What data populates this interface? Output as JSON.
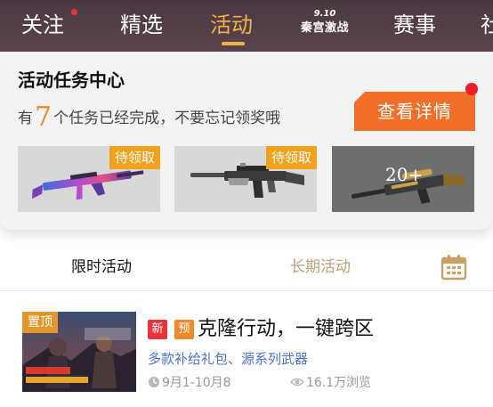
{
  "nav": {
    "tabs": [
      {
        "label": "关注",
        "has_dot": true
      },
      {
        "label": "精选"
      },
      {
        "label": "活动",
        "active": true
      },
      {
        "date": "9.10",
        "label": "秦宫激战"
      },
      {
        "label": "赛事"
      },
      {
        "label": "社"
      }
    ],
    "active_color": "#f4b04a"
  },
  "task_center": {
    "title": "活动任务中心",
    "subtitle_prefix": "有",
    "completed_count": "7",
    "subtitle_suffix": "个任务已经完成，不要忘记领奖哦",
    "detail_button": "查看详情",
    "rewards": [
      {
        "tag": "待领取",
        "icon": "colorful-rifle"
      },
      {
        "tag": "待领取",
        "icon": "silenced-rifle"
      },
      {
        "more_label": "20+",
        "icon": "sniper-rifle"
      }
    ]
  },
  "sub_tabs": {
    "limited": "限时活动",
    "long_term": "长期活动",
    "calendar_icon": "calendar-icon"
  },
  "activities": [
    {
      "pinned_label": "置顶",
      "new_badge": "新",
      "pre_badge": "预",
      "title": "克隆行动，一键跨区",
      "description": "多款补给礼包、源系列武器",
      "date_range": "9月1-10月8",
      "views": "16.1万浏览"
    }
  ],
  "colors": {
    "accent_orange": "#f26f2a",
    "tag_yellow": "#f0a21c",
    "link_blue": "#4a72c9",
    "badge_red": "#e8343a"
  }
}
